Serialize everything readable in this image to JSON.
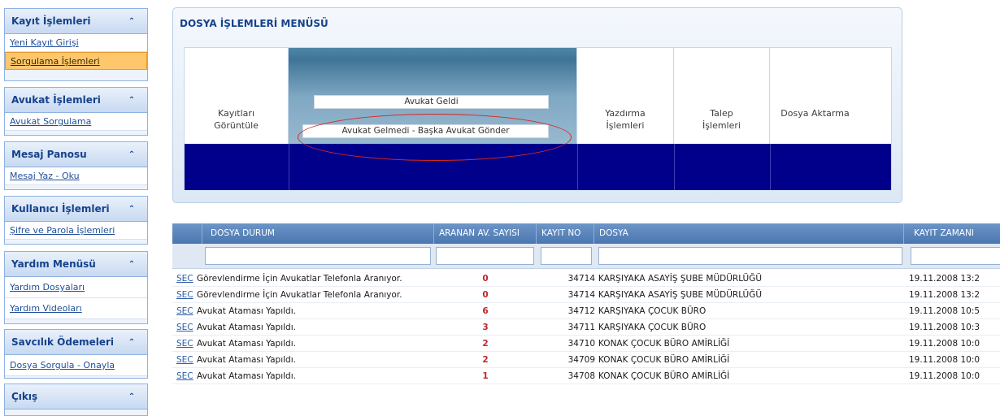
{
  "sidebar": {
    "panels": [
      {
        "title": "Kayıt İşlemleri",
        "chevron": "⌃",
        "items": [
          "Yeni Kayıt Girişi",
          "Sorgulama İşlemleri"
        ]
      },
      {
        "title": "Avukat İşlemleri",
        "chevron": "⌃",
        "items": [
          "Avukat Sorgulama"
        ]
      },
      {
        "title": "Mesaj Panosu",
        "chevron": "⌃",
        "items": [
          "Mesaj Yaz - Oku"
        ]
      },
      {
        "title": "Kullanıcı İşlemleri",
        "chevron": "⌃",
        "items": [
          "Şifre ve Parola İşlemleri"
        ]
      },
      {
        "title": "Yardım Menüsü",
        "chevron": "⌃",
        "items": [
          "Yardım Dosyaları",
          "Yardım Videoları"
        ]
      },
      {
        "title": "Savcılık Ödemeleri",
        "chevron": "⌃",
        "items": [
          "Dosya Sorgula - Onayla"
        ]
      },
      {
        "title": "Çıkış",
        "chevron": "⌃",
        "items": []
      }
    ],
    "active_item": "Sorgulama İşlemleri"
  },
  "menu": {
    "title": "DOSYA İŞLEMLERİ MENÜSÜ",
    "kayitlar_label": "Kayıtları Görüntüle",
    "option_geldi": "Avukat Geldi",
    "option_gelmedi": "Avukat Gelmedi - Başka Avukat Gönder",
    "yazdirma_label": "Yazdırma İşlemleri",
    "talep_label": "Talep İşlemleri",
    "dosya_aktarma_label": "Dosya Aktarma"
  },
  "grid": {
    "columns": [
      "DOSYA DURUM",
      "ARANAN AV. SAYISI",
      "KAYIT NO",
      "DOSYA",
      "KAYIT ZAMANI"
    ],
    "rows": [
      {
        "link": "SEC",
        "durum": "Görevlendirme İçin Avukatlar Telefonla Aranıyor.",
        "sayi": "0",
        "kayit_no": "34714",
        "dosya": "KARŞIYAKA ASAYİŞ ŞUBE MÜDÜRLÜĞÜ",
        "zaman": "19.11.2008 13:2"
      },
      {
        "link": "SEC",
        "durum": "Görevlendirme İçin Avukatlar Telefonla Aranıyor.",
        "sayi": "0",
        "kayit_no": "34714",
        "dosya": "KARŞIYAKA ASAYİŞ ŞUBE MÜDÜRLÜĞÜ",
        "zaman": "19.11.2008 13:2"
      },
      {
        "link": "SEC",
        "durum": "Avukat Ataması Yapıldı.",
        "sayi": "6",
        "kayit_no": "34712",
        "dosya": "KARŞIYAKA ÇOCUK BÜRO",
        "zaman": "19.11.2008 10:5"
      },
      {
        "link": "SEC",
        "durum": "Avukat Ataması Yapıldı.",
        "sayi": "3",
        "kayit_no": "34711",
        "dosya": "KARŞIYAKA ÇOCUK BÜRO",
        "zaman": "19.11.2008 10:3"
      },
      {
        "link": "SEC",
        "durum": "Avukat Ataması Yapıldı.",
        "sayi": "2",
        "kayit_no": "34710",
        "dosya": "KONAK ÇOCUK BÜRO AMİRLİĞİ",
        "zaman": "19.11.2008 10:0"
      },
      {
        "link": "SEC",
        "durum": "Avukat Ataması Yapıldı.",
        "sayi": "2",
        "kayit_no": "34709",
        "dosya": "KONAK ÇOCUK BÜRO AMİRLİĞİ",
        "zaman": "19.11.2008 10:0"
      },
      {
        "link": "SEC",
        "durum": "Avukat Ataması Yapıldı.",
        "sayi": "1",
        "kayit_no": "34708",
        "dosya": "KONAK ÇOCUK BÜRO AMİRLİĞİ",
        "zaman": "19.11.2008 10:0"
      }
    ]
  },
  "colors": {
    "band": "#00008b",
    "header": "#4a76b0",
    "active_item": "#ffc76b",
    "count_red": "#c0262d",
    "ellipse_red": "#d9261f"
  }
}
